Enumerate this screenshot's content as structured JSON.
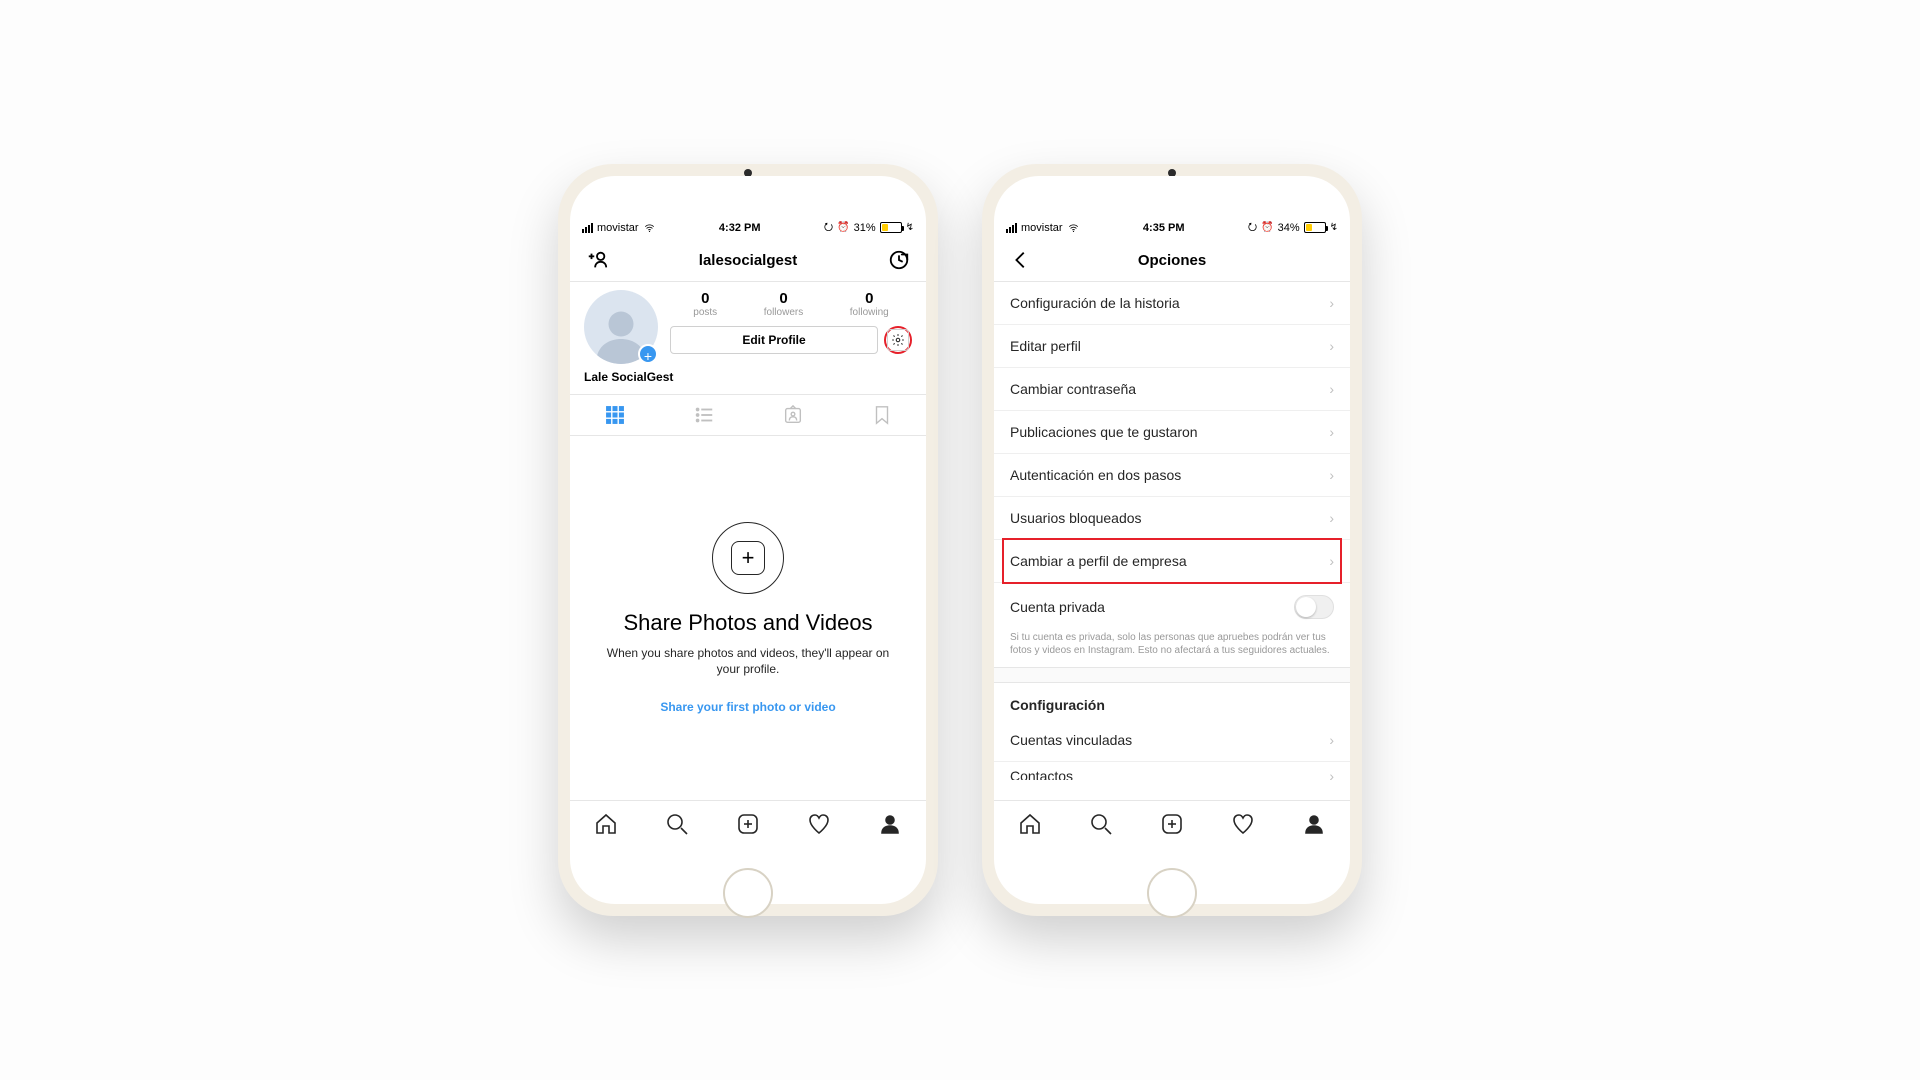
{
  "phone1": {
    "status": {
      "carrier": "movistar",
      "time": "4:32 PM",
      "battery_pct": "31%",
      "battery_fill_pct": 31
    },
    "header": {
      "username": "lalesocialgest"
    },
    "profile": {
      "posts_num": "0",
      "posts_lbl": "posts",
      "followers_num": "0",
      "followers_lbl": "followers",
      "following_num": "0",
      "following_lbl": "following",
      "edit_btn": "Edit Profile",
      "display_name": "Lale SocialGest"
    },
    "empty": {
      "title": "Share Photos and Videos",
      "sub": "When you share photos and videos, they'll appear on your profile.",
      "link": "Share your first photo or video"
    }
  },
  "phone2": {
    "status": {
      "carrier": "movistar",
      "time": "4:35 PM",
      "battery_pct": "34%",
      "battery_fill_pct": 34
    },
    "header": {
      "title": "Opciones"
    },
    "settings": {
      "item0": "Configuración de la historia",
      "item1": "Editar perfil",
      "item2": "Cambiar contraseña",
      "item3": "Publicaciones que te gustaron",
      "item4": "Autenticación en dos pasos",
      "item5": "Usuarios bloqueados",
      "item6": "Cambiar a perfil de empresa",
      "private_label": "Cuenta privada",
      "private_note": "Si tu cuenta es privada, solo las personas que apruebes podrán ver tus fotos y videos en Instagram. Esto no afectará a tus seguidores actuales.",
      "section2_title": "Configuración",
      "item7": "Cuentas vinculadas",
      "item8": "Contactos"
    }
  }
}
